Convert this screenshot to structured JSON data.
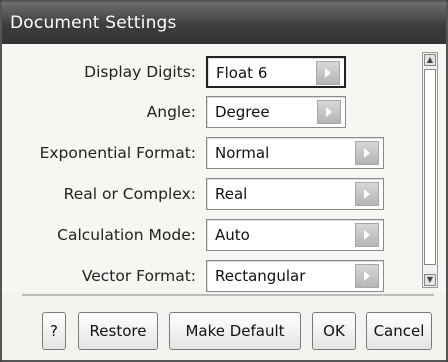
{
  "dialog": {
    "title": "Document Settings"
  },
  "settings": [
    {
      "label": "Display Digits:",
      "value": "Float 6"
    },
    {
      "label": "Angle:",
      "value": "Degree"
    },
    {
      "label": "Exponential Format:",
      "value": "Normal"
    },
    {
      "label": "Real or Complex:",
      "value": "Real"
    },
    {
      "label": "Calculation Mode:",
      "value": "Auto"
    },
    {
      "label": "Vector Format:",
      "value": "Rectangular"
    }
  ],
  "buttons": {
    "help": "?",
    "restore": "Restore",
    "make_default": "Make Default",
    "ok": "OK",
    "cancel": "Cancel"
  },
  "icons": {
    "dropdown": "triangle-right-icon",
    "scroll_up": "scroll-up-icon",
    "scroll_down": "scroll-down-icon"
  }
}
